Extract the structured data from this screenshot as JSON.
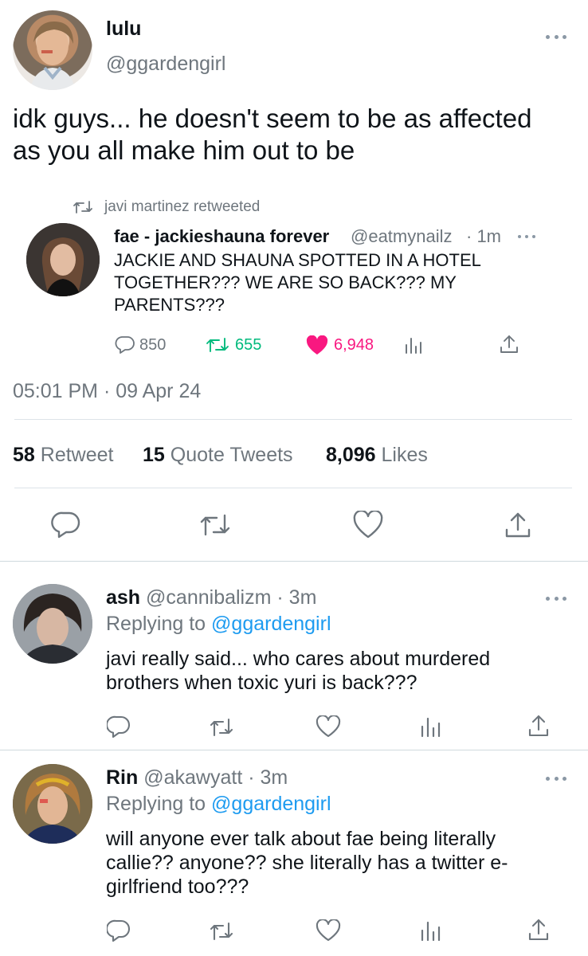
{
  "main_tweet": {
    "author_name": "lulu",
    "author_handle": "@ggardengirl",
    "text_line1": "idk guys... he doesn't seem to be as affected",
    "text_line2": "as you all make him out to be",
    "timestamp": "05:01 PM · 09 Apr 24",
    "stats": {
      "retweets_count": "58",
      "retweets_label": "Retweet",
      "quotes_count": "15",
      "quotes_label": "Quote Tweets",
      "likes_count": "8,096",
      "likes_label": "Likes"
    }
  },
  "quoted_tweet": {
    "retweeted_by": "javi martinez retweeted",
    "author_name": "fae - jackieshauna forever",
    "author_handle": "@eatmynailz",
    "time": "· 1m",
    "text_line1": "JACKIE AND SHAUNA SPOTTED IN A HOTEL",
    "text_line2": "TOGETHER??? WE ARE SO BACK??? MY",
    "text_line3": "PARENTS???",
    "replies": "850",
    "retweets": "655",
    "likes": "6,948"
  },
  "replies": [
    {
      "author_name": "ash",
      "author_handle": "@cannibalizm",
      "time": "· 3m",
      "replying_prefix": "Replying to",
      "replying_to": "@ggardengirl",
      "text_line1": "javi really said... who cares about murdered",
      "text_line2": "brothers when toxic yuri is back???"
    },
    {
      "author_name": "Rin",
      "author_handle": "@akawyatt",
      "time": "· 3m",
      "replying_prefix": "Replying to",
      "replying_to": "@ggardengirl",
      "text_line1": "will anyone ever talk about fae being literally",
      "text_line2": "callie?? anyone?? she literally has a twitter e-",
      "text_line3": "girlfriend too???"
    }
  ],
  "icons": {
    "reply": "reply-icon",
    "retweet": "retweet-icon",
    "like": "heart-icon",
    "views": "analytics-icon",
    "share": "share-icon",
    "more": "more-icon"
  },
  "colors": {
    "text": "#0f1419",
    "secondary": "#6e767d",
    "link": "#1d9bf0",
    "retweet_green": "#00ba7c",
    "like_pink": "#f91880"
  }
}
